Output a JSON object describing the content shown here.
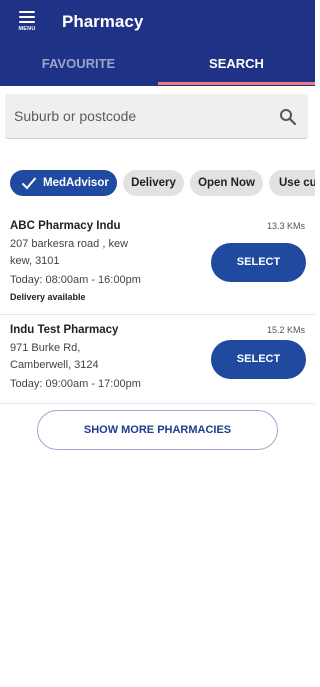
{
  "header": {
    "title": "Pharmacy",
    "menu_label": "MENU",
    "menu_icon": "hamburger-icon"
  },
  "tabs": [
    {
      "label": "FAVOURITE",
      "active": false
    },
    {
      "label": "SEARCH",
      "active": true
    }
  ],
  "search": {
    "placeholder": "Suburb or postcode",
    "value": "",
    "icon": "search-icon"
  },
  "filters": [
    {
      "label": "MedAdvisor",
      "selected": true,
      "icon": "check-icon"
    },
    {
      "label": "Delivery",
      "selected": false
    },
    {
      "label": "Open Now",
      "selected": false
    },
    {
      "label": "Use cu",
      "selected": false
    }
  ],
  "pharmacies": [
    {
      "name": "ABC Pharmacy Indu",
      "distance": "13.3 KMs",
      "address_line1": "207 barkesra road , kew",
      "address_line2": "kew, 3101",
      "hours": "Today: 08:00am - 16:00pm",
      "extra": "Delivery available",
      "button": "SELECT"
    },
    {
      "name": "Indu Test Pharmacy",
      "distance": "15.2 KMs",
      "address_line1": "971 Burke Rd,",
      "address_line2": "Camberwell, 3124",
      "hours": "Today: 09:00am - 17:00pm",
      "button": "SELECT"
    }
  ],
  "show_more_label": "SHOW MORE PHARMACIES",
  "colors": {
    "primary": "#1f3286",
    "button": "#1f4aa0",
    "tab_indicator": "#f07a82",
    "chip_bg": "#e2e2e2"
  }
}
